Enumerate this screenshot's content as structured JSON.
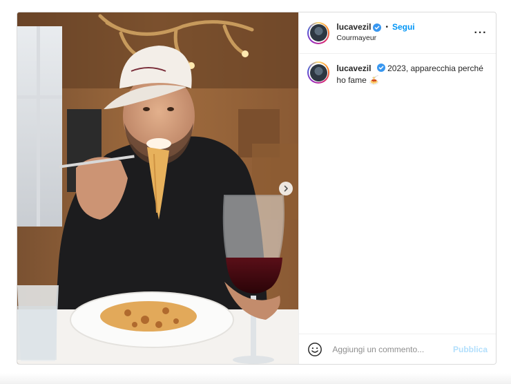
{
  "post": {
    "author": {
      "username": "lucavezil",
      "verified": true,
      "follow_label": "Segui",
      "separator": "•",
      "location": "Courmayeur"
    },
    "more_icon": "more-options-icon",
    "caption": {
      "username": "lucavezil",
      "text": "2023, apparecchia perché ho fame 🍝"
    },
    "media": {
      "next_icon": "chevron-right-icon"
    },
    "comment_box": {
      "emoji_icon": "emoji-smile-icon",
      "placeholder": "Aggiungi un commento...",
      "publish_label": "Pubblica"
    }
  },
  "colors": {
    "link_blue": "#0095f6",
    "publish_disabled": "#b2dffc",
    "verified_blue": "#3897f0",
    "text": "#262626"
  }
}
